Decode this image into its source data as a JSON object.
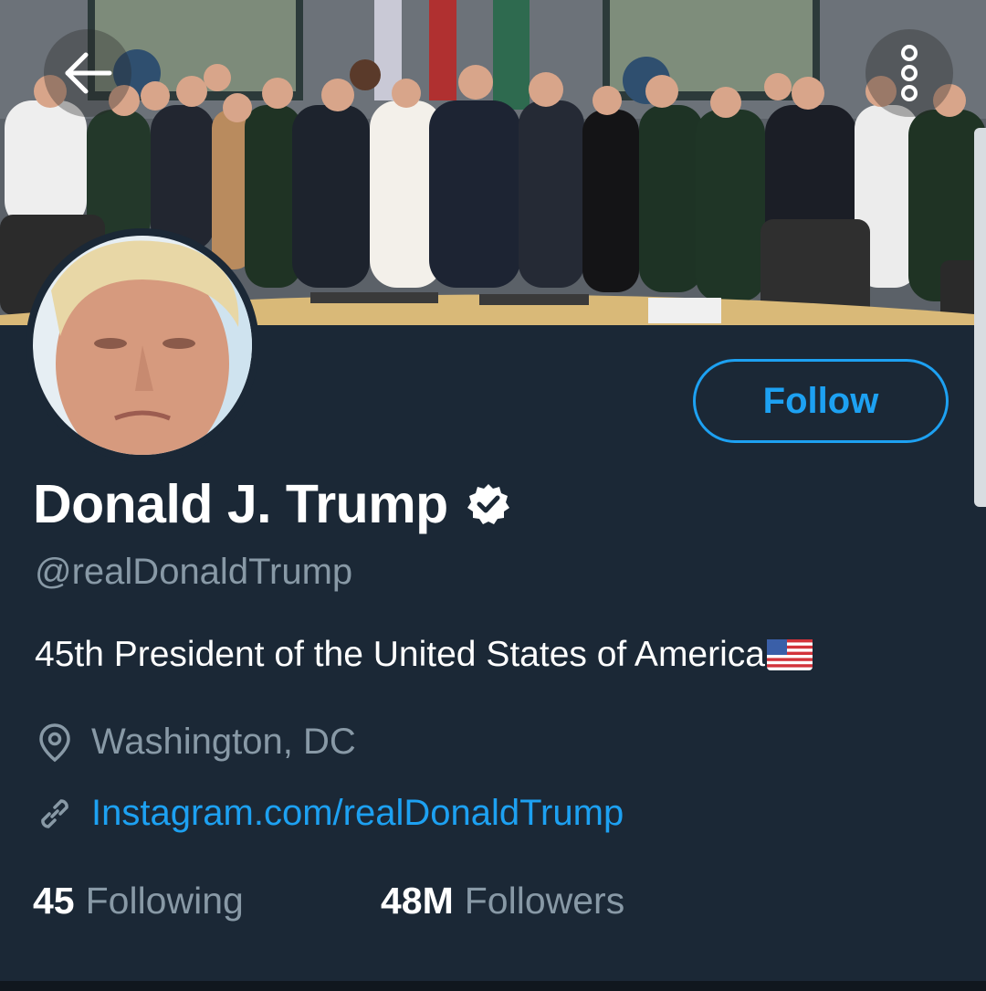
{
  "profile": {
    "name": "Donald J. Trump",
    "handle": "@realDonaldTrump",
    "bio": "45th President of the United States of America",
    "bio_emoji": "us-flag",
    "location": "Washington, DC",
    "website": "Instagram.com/realDonaldTrump",
    "verified": true
  },
  "actions": {
    "follow_label": "Follow"
  },
  "stats": {
    "following_count": "45",
    "following_label": "Following",
    "followers_count": "48M",
    "followers_label": "Followers"
  },
  "icons": {
    "back": "arrow-left-icon",
    "more": "more-vertical-icon",
    "verified": "verified-badge-icon",
    "location": "location-pin-icon",
    "link": "link-icon"
  },
  "colors": {
    "background": "#1b2836",
    "accent": "#1da1f2",
    "secondary_text": "#8899a6",
    "primary_text": "#ffffff"
  }
}
